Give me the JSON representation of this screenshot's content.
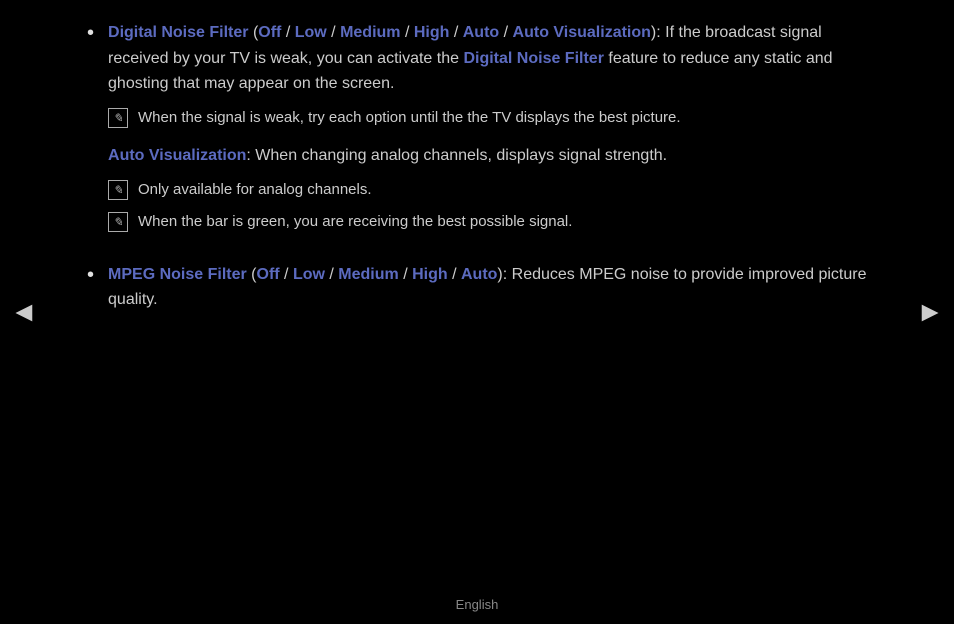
{
  "nav": {
    "left_arrow": "◄",
    "right_arrow": "►"
  },
  "footer": {
    "language": "English"
  },
  "bullets": [
    {
      "id": "digital-noise-filter",
      "title": "Digital Noise Filter",
      "options": [
        {
          "label": "Off",
          "separator": " / "
        },
        {
          "label": "Low",
          "separator": " / "
        },
        {
          "label": "Medium",
          "separator": " / "
        },
        {
          "label": "High",
          "separator": " / "
        },
        {
          "label": "Auto",
          "separator": " / "
        },
        {
          "label": "Auto Visualization",
          "separator": ""
        }
      ],
      "suffix": "):",
      "description_prefix": "If the broadcast signal received by your TV is weak, you can activate the ",
      "description_link": "Digital Noise Filter",
      "description_suffix": " feature to reduce any static and ghosting that may appear on the screen.",
      "notes": [
        {
          "text": "When the signal is weak, try each option until the the TV displays the best picture."
        }
      ],
      "subsection": {
        "title": "Auto Visualization",
        "colon_text": ": When changing analog channels, displays signal strength.",
        "notes": [
          {
            "text": "Only available for analog channels."
          },
          {
            "text": "When the bar is green, you are receiving the best possible signal."
          }
        ]
      }
    },
    {
      "id": "mpeg-noise-filter",
      "title": "MPEG Noise Filter",
      "options": [
        {
          "label": "Off",
          "separator": " / "
        },
        {
          "label": "Low",
          "separator": " / "
        },
        {
          "label": "Medium",
          "separator": " / "
        },
        {
          "label": "High",
          "separator": " / "
        },
        {
          "label": "Auto",
          "separator": ""
        }
      ],
      "suffix": "): Reduces MPEG noise to provide improved picture quality.",
      "notes": []
    }
  ]
}
